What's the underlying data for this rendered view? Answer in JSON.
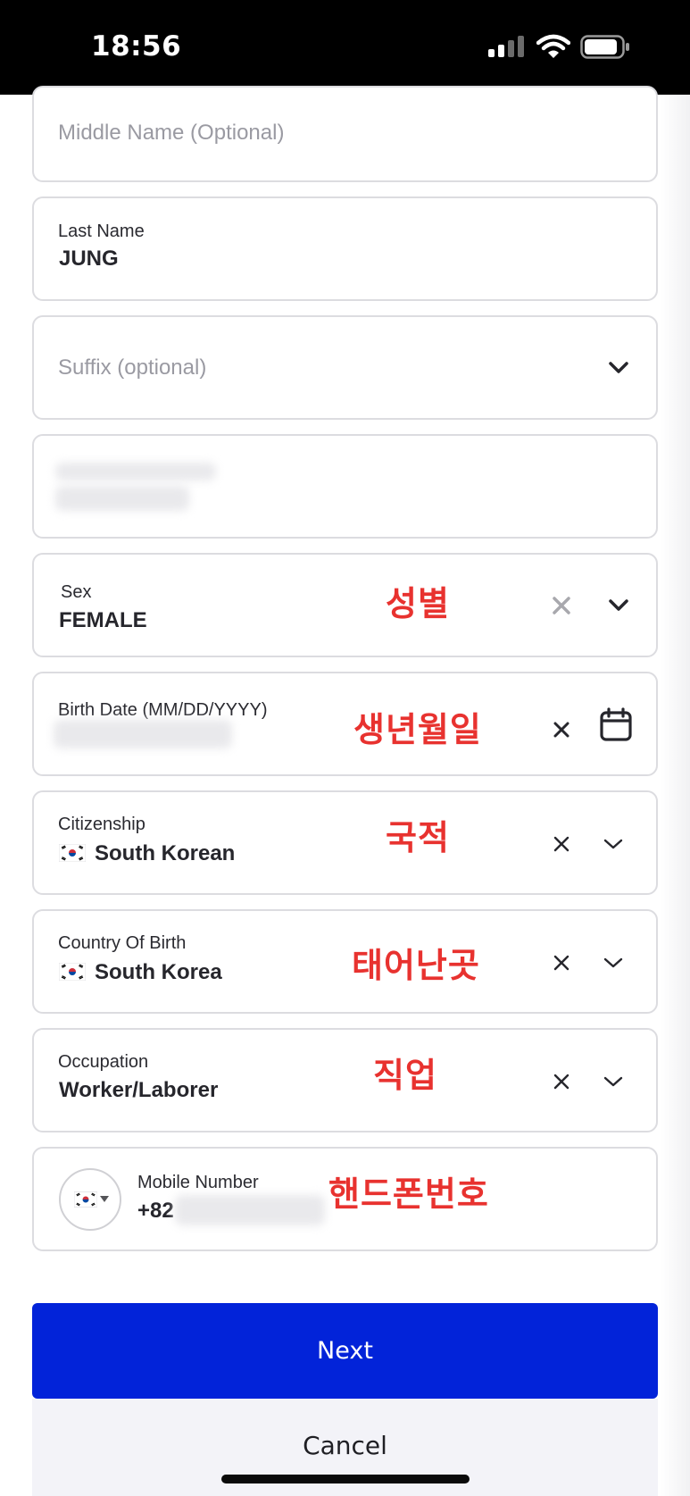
{
  "status_bar": {
    "time": "18:56"
  },
  "fields": {
    "middle_name": {
      "placeholder": "Middle Name (Optional)"
    },
    "last_name": {
      "label": "Last Name",
      "value": "JUNG"
    },
    "suffix": {
      "placeholder": "Suffix (optional)"
    },
    "sex": {
      "label": "Sex",
      "value": "FEMALE",
      "annotation": "성별"
    },
    "birth_date": {
      "label": "Birth Date (MM/DD/YYYY)",
      "annotation": "생년월일"
    },
    "citizenship": {
      "label": "Citizenship",
      "value": "South Korean",
      "annotation": "국적"
    },
    "country_of_birth": {
      "label": "Country Of Birth",
      "value": "South Korea",
      "annotation": "태어난곳"
    },
    "occupation": {
      "label": "Occupation",
      "value": "Worker/Laborer",
      "annotation": "직업"
    },
    "mobile_number": {
      "label": "Mobile Number",
      "prefix": "+82",
      "annotation": "핸드폰번호"
    }
  },
  "buttons": {
    "next": "Next",
    "cancel": "Cancel"
  },
  "icons": {
    "dropdown": "chevron-down-icon",
    "clear": "close-icon",
    "calendar": "calendar-icon",
    "flag": "south-korea-flag-icon"
  },
  "colors": {
    "primary_button": "#0223d9",
    "annotation_red": "#e8322f",
    "field_border": "#dcdce0",
    "placeholder_text": "#9a9aa2"
  }
}
